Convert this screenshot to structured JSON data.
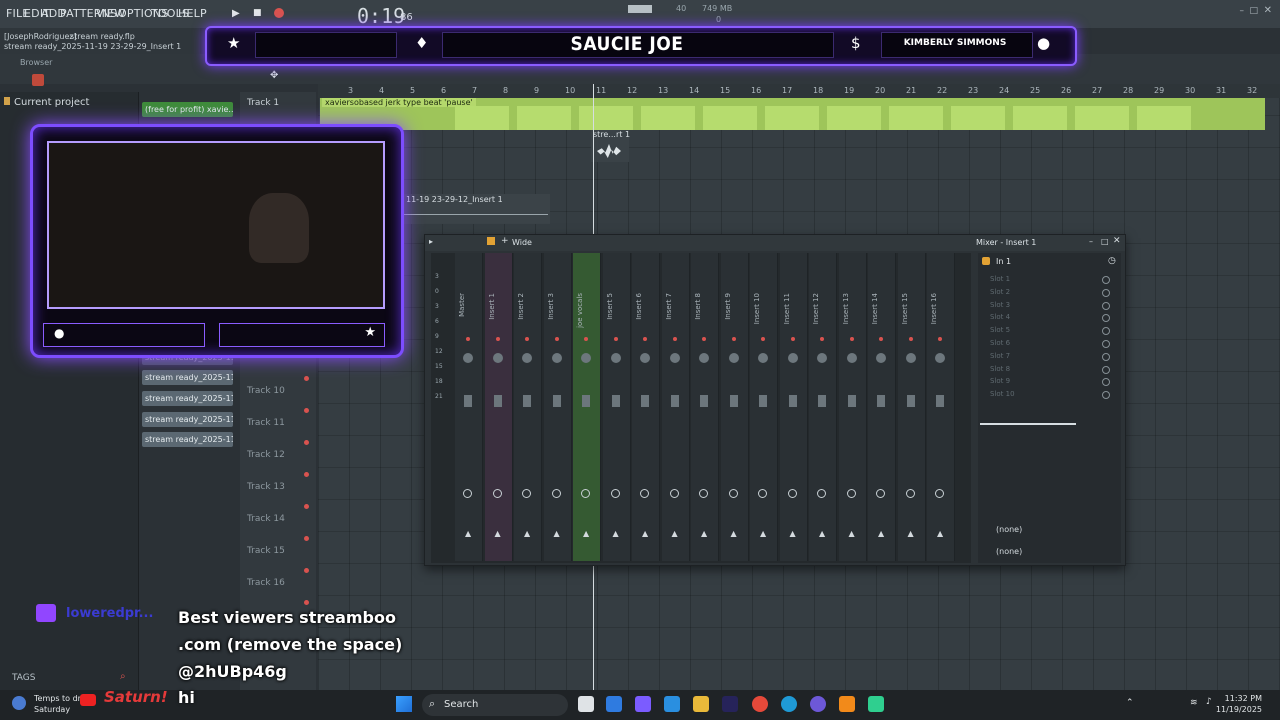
{
  "menubar": {
    "items": [
      "FILE",
      "EDIT",
      "ADD",
      "PATTERNS",
      "VIEW",
      "OPTIONS",
      "TOOLS",
      "HELP"
    ],
    "timer": "0:19",
    "timer_frac": "86",
    "tempo_value": "40",
    "memory": "749 MB",
    "mem_sub": "0"
  },
  "project": {
    "user": "[JosephRodriguez]",
    "file": "stream ready.flp",
    "insert_line": "stream ready_2025-11-19 23-29-29_Insert 1"
  },
  "browser": {
    "label": "Browser",
    "current_project": "Current project",
    "tags": "TAGS"
  },
  "overlay_banner": {
    "title": "SAUCIE JOE",
    "name": "KIMBERLY SIMMONS"
  },
  "clips": {
    "top": "(free for profit) xavie...",
    "items": [
      "stream ready_2025-11-1...",
      "stream ready_2025-11-1...",
      "stream ready_2025-11-1...",
      "stream ready_2025-11-1...",
      "stream ready_2025-11-1..."
    ]
  },
  "tracks": {
    "first": "Track 1",
    "list": [
      "Track 10",
      "Track 11",
      "Track 12",
      "Track 13",
      "Track 14",
      "Track 15",
      "Track 16"
    ]
  },
  "playlist": {
    "beat_label": "xaviersobased jerk type beat 'pause'",
    "clip_small": "stre...rt 1",
    "clip_insert": "11-19 23-29-12_Insert 1",
    "ruler": [
      "3",
      "4",
      "5",
      "6",
      "7",
      "8",
      "9",
      "10",
      "11",
      "12",
      "13",
      "14",
      "15",
      "16",
      "17",
      "18",
      "19",
      "20",
      "21",
      "22",
      "23",
      "24",
      "25",
      "26",
      "27",
      "28",
      "29",
      "30",
      "31",
      "32"
    ]
  },
  "mixer": {
    "preset": "Wide",
    "title": "Mixer - Insert 1",
    "input": "In 1",
    "strips": [
      "Master",
      "Insert 1",
      "Insert 2",
      "Insert 3",
      "joe vocals",
      "Insert 5",
      "Insert 6",
      "Insert 7",
      "Insert 8",
      "Insert 9",
      "Insert 10",
      "Insert 11",
      "Insert 12",
      "Insert 13",
      "Insert 14",
      "Insert 15",
      "Insert 16"
    ],
    "slots": [
      "Slot 1",
      "Slot 2",
      "Slot 3",
      "Slot 4",
      "Slot 5",
      "Slot 6",
      "Slot 7",
      "Slot 8",
      "Slot 9",
      "Slot 10"
    ],
    "out_none_1": "(none)",
    "out_none_2": "(none)",
    "db_marks": [
      "3",
      "0",
      "3",
      "6",
      "9",
      "12",
      "15",
      "18",
      "21"
    ]
  },
  "chat": {
    "user": "loweredpr...",
    "line1": "Best viewers streamboo",
    "line2": ".com (remove the space)",
    "line3": "@2hUBp46g",
    "user2": "Saturn!",
    "msg2": "hi"
  },
  "taskbar": {
    "weather_line1": "Temps to dr...",
    "weather_line2": "Saturday",
    "search": "Search",
    "time": "11:32 PM",
    "date": "11/19/2025"
  },
  "colors": {
    "accent_purple": "#8a5cff",
    "beat_green": "#9ec55a",
    "vocal_green": "#355a32",
    "record_red": "#d9534f"
  }
}
